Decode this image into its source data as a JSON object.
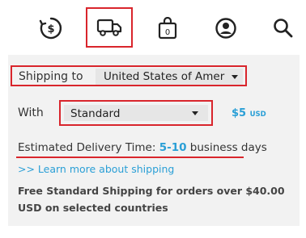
{
  "icons": {
    "currency": "currency-dollar-icon",
    "shipping": "truck-icon",
    "bag": "shopping-bag-icon",
    "account": "user-icon",
    "search": "search-icon"
  },
  "bag_count": "0",
  "shipping": {
    "label": "Shipping to",
    "country": "United States of America"
  },
  "method": {
    "label": "With",
    "value": "Standard",
    "price": "$5",
    "currency": "USD"
  },
  "estimate": {
    "prefix": "Estimated Delivery Time: ",
    "days": "5-10",
    "suffix": " business days"
  },
  "learn_more": ">> Learn more about shipping",
  "free_shipping": "Free Standard Shipping for orders over $40.00 USD on selected countries",
  "colors": {
    "accent": "#2a9fd6",
    "highlight": "#d9252c",
    "panel": "#f2f2f2"
  }
}
